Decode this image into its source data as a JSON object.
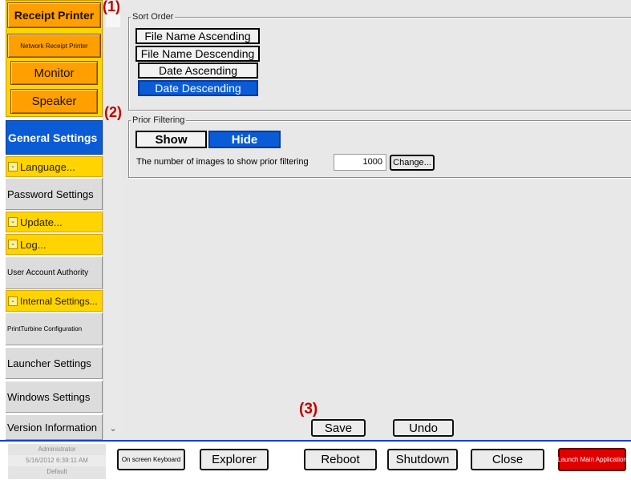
{
  "sidebar": {
    "top_buttons": [
      {
        "label": "Receipt Printer"
      },
      {
        "label": "Network Receipt Printer"
      },
      {
        "label": "Monitor"
      },
      {
        "label": "Speaker"
      }
    ],
    "items": [
      {
        "label": "General Settings",
        "style": "selected"
      },
      {
        "label": "Language...",
        "style": "collapsible"
      },
      {
        "label": "Password Settings",
        "style": "normal"
      },
      {
        "label": "Update...",
        "style": "collapsible"
      },
      {
        "label": "Log...",
        "style": "collapsible"
      },
      {
        "label": "User Account Authority",
        "style": "normal"
      },
      {
        "label": "Internal Settings...",
        "style": "collapsible"
      },
      {
        "label": "PrintTurbine Configuration",
        "style": "normal"
      },
      {
        "label": "Launcher Settings",
        "style": "normal"
      },
      {
        "label": "Windows Settings",
        "style": "normal"
      },
      {
        "label": "Version Information",
        "style": "normal"
      }
    ],
    "scroll_down_glyph": "⌄"
  },
  "annotations": {
    "a1": "(1)",
    "a2": "(2)",
    "a3": "(3)"
  },
  "sort_order": {
    "title": "Sort Order",
    "options": [
      {
        "label": "File Name Ascending",
        "selected": false
      },
      {
        "label": "File Name Descending",
        "selected": false
      },
      {
        "label": "Date Ascending",
        "selected": false
      },
      {
        "label": "Date Descending",
        "selected": true
      }
    ]
  },
  "prior_filtering": {
    "title": "Prior Filtering",
    "show_label": "Show",
    "hide_label": "Hide",
    "selected": "Hide",
    "count_label": "The number of images to show prior filtering",
    "count_value": "1000",
    "change_label": "Change..."
  },
  "actions": {
    "save": "Save",
    "undo": "Undo"
  },
  "bottom": {
    "status": {
      "user": "Administrator",
      "datetime": "5/16/2012 6:39:11 AM",
      "profile": "Default"
    },
    "buttons": {
      "keyboard": "On screen Keyboard",
      "explorer": "Explorer",
      "reboot": "Reboot",
      "shutdown": "Shutdown",
      "close": "Close",
      "launch": "Launch Main Application"
    }
  },
  "colors": {
    "accent_blue": "#0a5cd6",
    "nav_yellow": "#ffd400",
    "orange_button": "#ffa000",
    "launch_red": "#e00000",
    "annotation_red": "#c00000"
  }
}
